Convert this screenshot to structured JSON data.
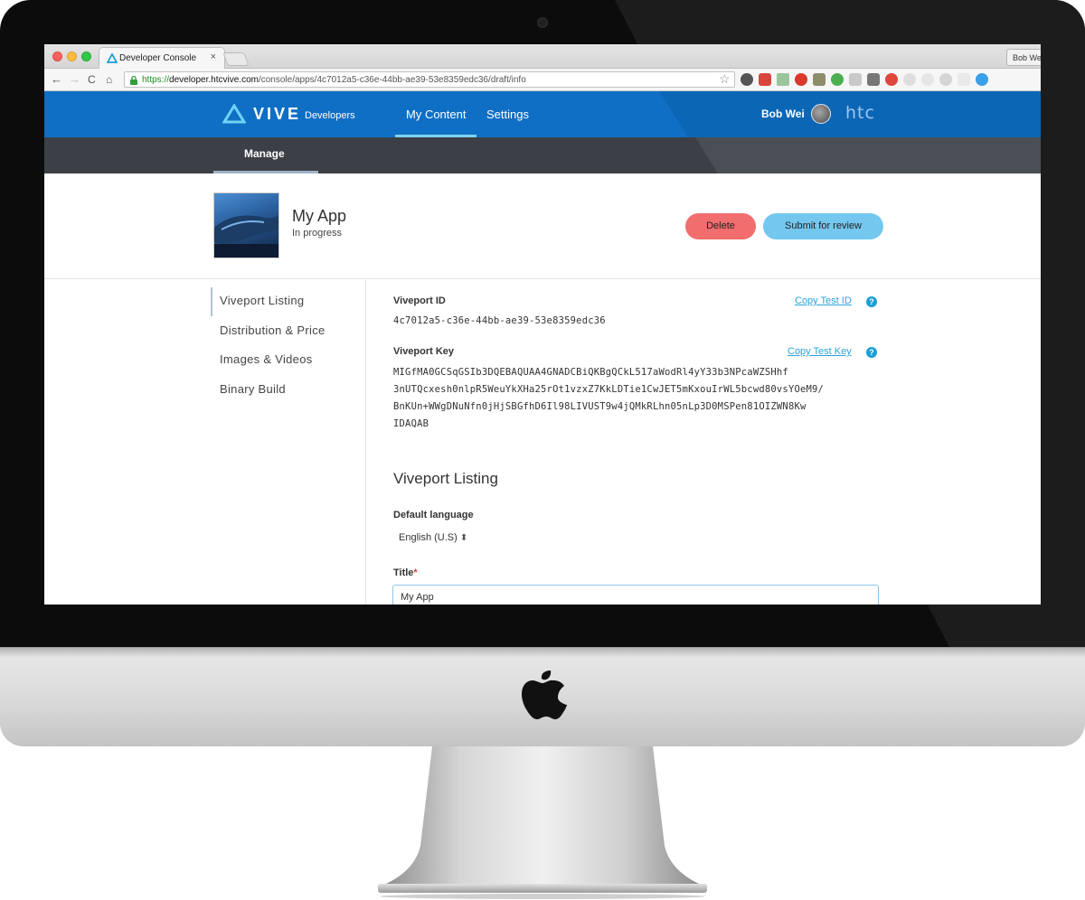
{
  "browser": {
    "tab_title": "Developer Console",
    "tab_close": "×",
    "profile_label": "Bob Wei",
    "url_scheme": "https://",
    "url_host": "developer.htcvive.com",
    "url_path": "/console/apps/4c7012a5-c36e-44bb-ae39-53e8359edc36/draft/info",
    "nav_back": "←",
    "nav_forward": "→",
    "nav_reload": "C",
    "nav_home": "⌂",
    "star": "☆"
  },
  "header": {
    "logo_text": "VIVE",
    "logo_sub": "Developers",
    "nav": [
      {
        "label": "My Content"
      },
      {
        "label": "Settings"
      }
    ],
    "user_name": "Bob Wei",
    "brand": "htc"
  },
  "subnav": {
    "tab": "Manage"
  },
  "app": {
    "name": "My App",
    "status": "In progress",
    "delete_label": "Delete",
    "submit_label": "Submit for review"
  },
  "sidebar": {
    "items": [
      {
        "label": "Viveport Listing"
      },
      {
        "label": "Distribution & Price"
      },
      {
        "label": "Images & Videos"
      },
      {
        "label": "Binary Build"
      }
    ]
  },
  "content": {
    "viveport_id_label": "Viveport ID",
    "viveport_id": "4c7012a5-c36e-44bb-ae39-53e8359edc36",
    "copy_test_id": "Copy Test ID",
    "viveport_key_label": "Viveport Key",
    "copy_test_key": "Copy Test Key",
    "help_glyph": "?",
    "key_lines": [
      "MIGfMA0GCSqGSIb3DQEBAQUAA4GNADCBiQKBgQCkL517aWodRl4yY33b3NPcaWZSHhf",
      "3nUTQcxesh0nlpR5WeuYkXHa25rOt1vzxZ7KkLDTie1CwJET5mKxouIrWL5bcwd80vsYOeM9/",
      "BnKUn+WWgDNuNfn0jHjSBGfhD6Il98LIVUST9w4jQMkRLhn05nLp3D0MSPen81OIZWN8Kw",
      "IDAQAB"
    ],
    "section_heading": "Viveport Listing",
    "default_language_label": "Default language",
    "default_language_value": "English (U.S)",
    "select_glyph": "⬍",
    "title_label": "Title",
    "title_required": "*",
    "title_value": "My App"
  },
  "colors": {
    "header_blue": "#0f6fc5",
    "subheader_dark": "#3c4046",
    "delete_red": "#f26d6d",
    "submit_blue": "#74c7ef",
    "link_blue": "#2aa3d8"
  }
}
